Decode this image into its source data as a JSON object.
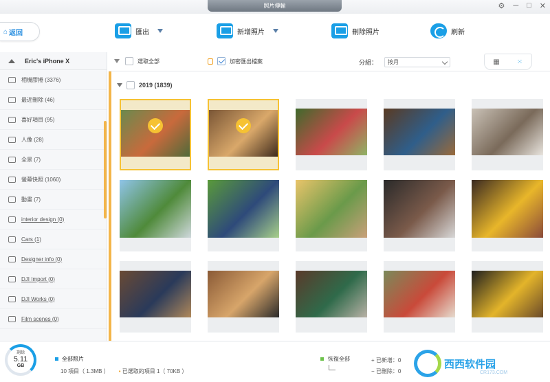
{
  "window": {
    "title": "照片傳輸",
    "controls": [
      "⚙",
      "─",
      "□",
      "✕"
    ]
  },
  "toolbar": {
    "back_label": "返回",
    "export_label": "匯出",
    "add_label": "新增照片",
    "delete_label": "刪除照片",
    "refresh_label": "刷新"
  },
  "sidebar": {
    "device_name": "Eric's iPhone X",
    "items": [
      {
        "label": "相機膠捲 (3376)",
        "icon": "camera-icon"
      },
      {
        "label": "最近刪除 (46)",
        "icon": "trash-icon"
      },
      {
        "label": "喜好項目 (95)",
        "icon": "heart-icon"
      },
      {
        "label": "人像 (28)",
        "icon": "cube-icon"
      },
      {
        "label": "全景 (7)",
        "icon": "panorama-icon"
      },
      {
        "label": "螢幕快照 (1060)",
        "icon": "screenshot-icon"
      },
      {
        "label": "動畫 (7)",
        "icon": "animation-icon"
      },
      {
        "label": "interior design (0)",
        "icon": "album-icon"
      },
      {
        "label": "Cars (1)",
        "icon": "album-icon"
      },
      {
        "label": "Designer info (0)",
        "icon": "album-icon"
      },
      {
        "label": "DJI Import (0)",
        "icon": "album-icon"
      },
      {
        "label": "DJI Works (0)",
        "icon": "album-icon"
      },
      {
        "label": "Film scenes (0)",
        "icon": "album-icon"
      }
    ]
  },
  "filter": {
    "select_all": "選取全部",
    "encrypt_export": "加密匯出檔案",
    "group_label": "分組：",
    "group_value": "按月"
  },
  "content": {
    "year_label": "2019 (1839)",
    "photos": [
      {
        "colors": [
          "#6b8a4e",
          "#c86a3c",
          "#4f6a3a"
        ],
        "selected": true
      },
      {
        "colors": [
          "#7a5636",
          "#d9a86a",
          "#3e2a1c"
        ],
        "selected": true
      },
      {
        "colors": [
          "#3f6a2c",
          "#c94a4a",
          "#8fb466"
        ],
        "selected": false
      },
      {
        "colors": [
          "#5a3a22",
          "#2f5e8a",
          "#9a6a3a"
        ],
        "selected": false
      },
      {
        "colors": [
          "#c9c1b6",
          "#7a6a5a",
          "#e8e4de"
        ],
        "selected": false
      },
      {
        "colors": [
          "#8fc4e8",
          "#4f8a3a",
          "#cfd8dc"
        ],
        "selected": false
      },
      {
        "colors": [
          "#5a9a3a",
          "#2e4a7a",
          "#a8d08a"
        ],
        "selected": false
      },
      {
        "colors": [
          "#e9c46a",
          "#6a9a4a",
          "#c9a07a"
        ],
        "selected": false
      },
      {
        "colors": [
          "#2a2a2a",
          "#7a5a4a",
          "#d8d8d8"
        ],
        "selected": false
      },
      {
        "colors": [
          "#3a2a22",
          "#e8b62a",
          "#8a4a3a"
        ],
        "selected": false
      },
      {
        "colors": [
          "#6a4a34",
          "#2a3a5a",
          "#b0885a"
        ],
        "selected": false
      },
      {
        "colors": [
          "#8a5a36",
          "#d7a56a",
          "#2a2a2a"
        ],
        "selected": false
      },
      {
        "colors": [
          "#5a3a2a",
          "#2f6a4a",
          "#b9b1a6"
        ],
        "selected": false
      },
      {
        "colors": [
          "#7a8a5a",
          "#c94a3a",
          "#e6dccf"
        ],
        "selected": false
      },
      {
        "colors": [
          "#1f1f1f",
          "#e3b42a",
          "#6a4a2a"
        ],
        "selected": false
      }
    ]
  },
  "bottom": {
    "storage_label": "剩餘",
    "storage_value": "5.11",
    "storage_unit": "GB",
    "all_photos": "全部照片",
    "item_count": "10 項目（ 1.3MB ）",
    "selected_count": "已選取的項目 1（ 70KB ）",
    "restore_all": "恢復全部",
    "added_label": "已新增：",
    "added_value": "0",
    "deleted_label": "已刪除：",
    "deleted_value": "0",
    "watermark_text": "西西软件园",
    "watermark_sub": "CR173.COM",
    "accent": "#1a9fe6",
    "selected_color": "#f0a020",
    "restore_color": "#6cc24a"
  }
}
